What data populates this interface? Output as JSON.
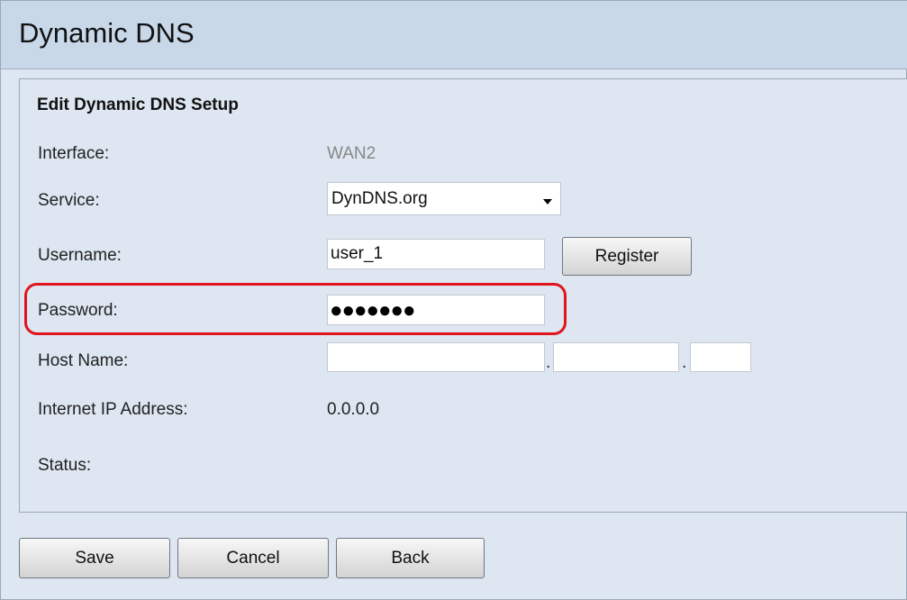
{
  "page": {
    "title": "Dynamic DNS"
  },
  "form": {
    "section_title": "Edit Dynamic DNS Setup",
    "interface": {
      "label": "Interface:",
      "value": "WAN2"
    },
    "service": {
      "label": "Service:",
      "selected": "DynDNS.org"
    },
    "username": {
      "label": "Username:",
      "value": "user_1",
      "register_label": "Register"
    },
    "password": {
      "label": "Password:",
      "masked_value": "●●●●●●●"
    },
    "host_name": {
      "label": "Host Name:",
      "part1": "",
      "part2": "",
      "part3": "",
      "separator": "."
    },
    "internet_ip": {
      "label": "Internet IP Address:",
      "value": "0.0.0.0"
    },
    "status": {
      "label": "Status:",
      "value": ""
    }
  },
  "actions": {
    "save_label": "Save",
    "cancel_label": "Cancel",
    "back_label": "Back"
  },
  "colors": {
    "highlight": "#e0141e",
    "title_bar": "#c8d8e9",
    "panel_bg": "#dde6f1"
  },
  "icons": {
    "dropdown": "chevron-down-icon"
  }
}
